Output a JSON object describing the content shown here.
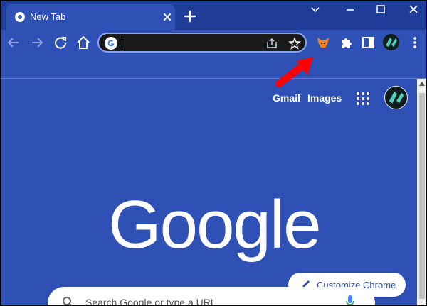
{
  "tab": {
    "title": "New Tab"
  },
  "omnibox": {
    "value": ""
  },
  "links": {
    "gmail": "Gmail",
    "images": "Images"
  },
  "logo": {
    "text": "Google"
  },
  "customize": {
    "label": "Customize Chrome"
  },
  "search": {
    "placeholder": "Search Google or type a URL"
  },
  "colors": {
    "page": "#2f51b5",
    "titlebar": "#1f3c98",
    "annotation_arrow": "#ff0000"
  },
  "icons": [
    "chrome-icon",
    "close-icon",
    "plus-icon",
    "minimize-icon",
    "maximize-icon",
    "window-close-icon",
    "back-icon",
    "forward-icon",
    "reload-icon",
    "home-icon",
    "google-g-icon",
    "share-icon",
    "star-icon",
    "metamask-fox-icon",
    "extensions-puzzle-icon",
    "side-panel-icon",
    "avatar",
    "kebab-menu-icon",
    "apps-grid-icon",
    "pencil-icon",
    "search-icon",
    "mic-icon",
    "red-arrow-annotation"
  ]
}
